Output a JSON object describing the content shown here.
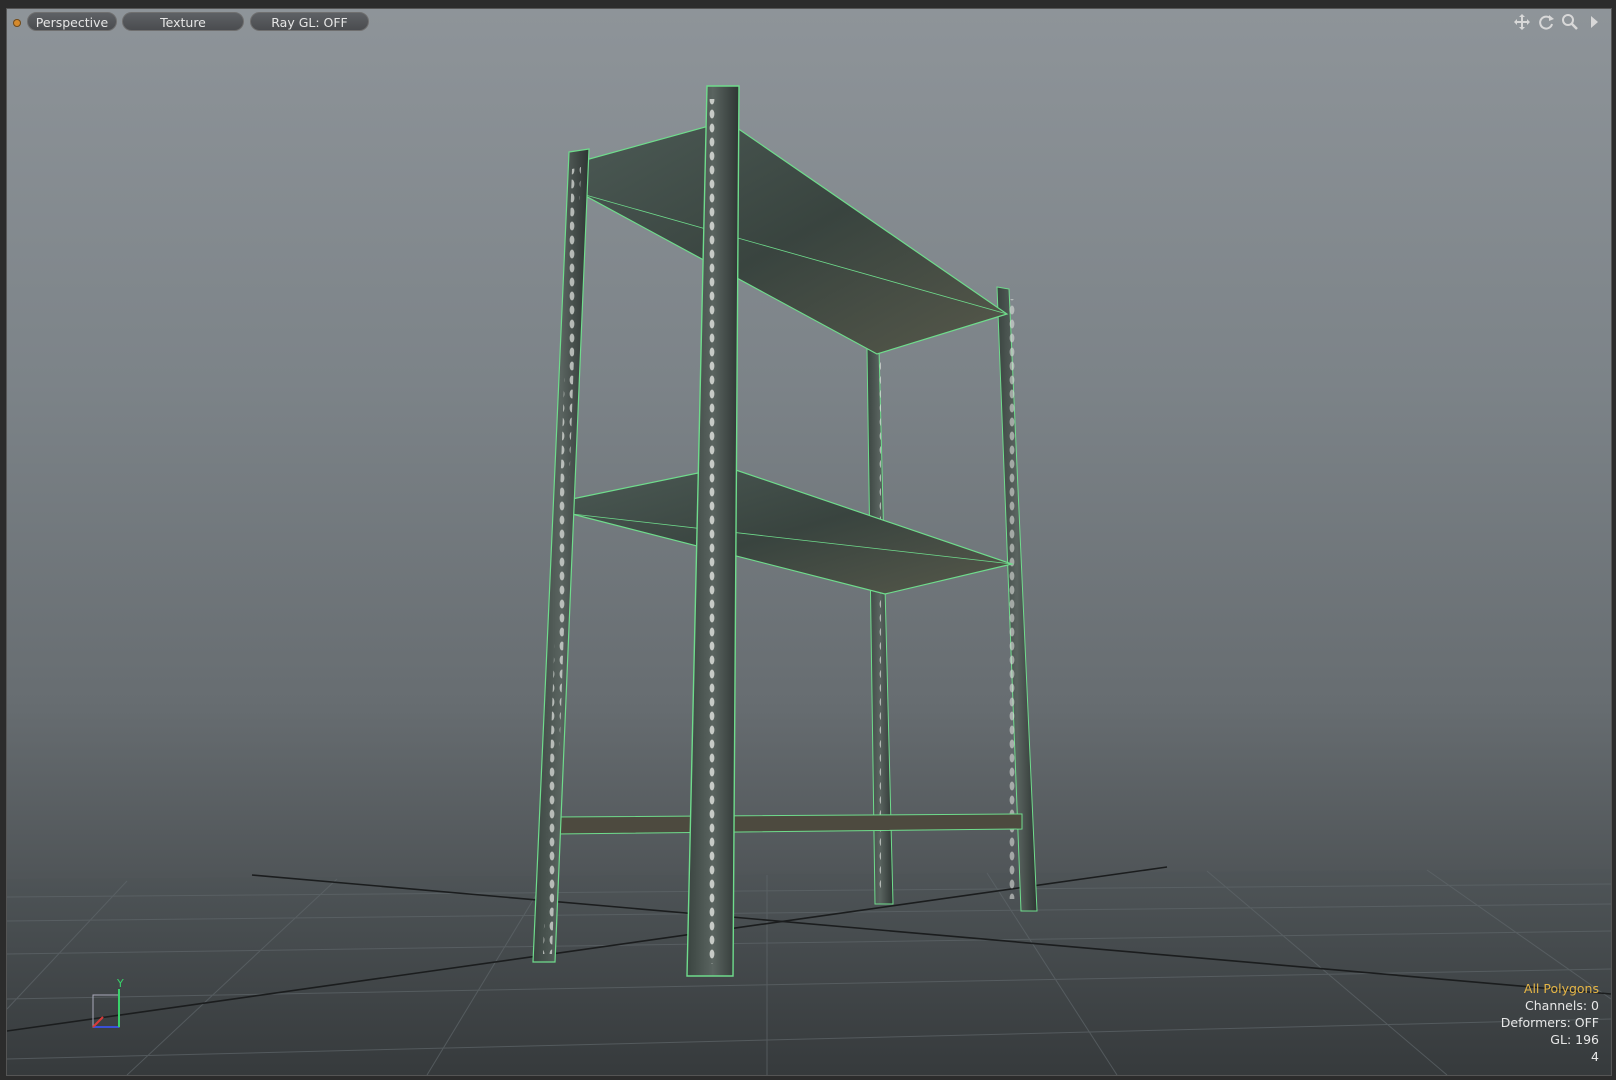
{
  "toolbar": {
    "view_button": "Perspective",
    "shading_button": "Texture",
    "raygl_button": "Ray GL: OFF"
  },
  "nav_icons": [
    "move-view-icon",
    "rotate-view-icon",
    "zoom-view-icon",
    "expand-arrow-icon"
  ],
  "hud": {
    "selection_mode": "All Polygons",
    "channels": "Channels: 0",
    "deformers": "Deformers: OFF",
    "gl": "GL: 196",
    "count": "4"
  },
  "axes": {
    "y_label": "Y"
  },
  "colors": {
    "accent_orange": "#e6b646",
    "wireframe_green": "#6fdc8c",
    "viewport_top": "#8e9499",
    "viewport_bottom": "#3e4245"
  }
}
